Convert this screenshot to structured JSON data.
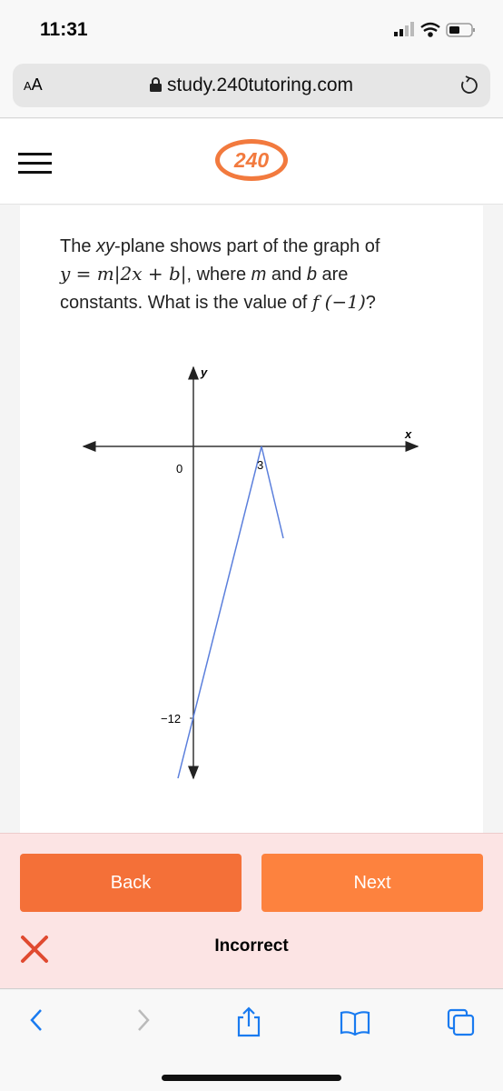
{
  "status_bar": {
    "time": "11:31",
    "icons": [
      "signal-icon",
      "wifi-icon",
      "battery-icon"
    ]
  },
  "browser": {
    "text_size_label_small": "A",
    "text_size_label_large": "A",
    "url": "study.240tutoring.com",
    "lock_icon": "lock-icon",
    "reload_icon": "reload-icon"
  },
  "header": {
    "menu_icon": "hamburger-icon",
    "logo_text": "240",
    "brand_color": "#f27a3e"
  },
  "question": {
    "line1_pre": "The ",
    "line1_em": "xy",
    "line1_post": "-plane shows part of the graph of",
    "equation": "y = m|2x + b|",
    "line2_post": ", where ",
    "m": "m",
    "and": " and ",
    "b": "b",
    "are": " are",
    "line3": "constants. What is the value of ",
    "expr": "f (−1)",
    "qmark": "?"
  },
  "graph": {
    "x_label": "x",
    "y_label": "y",
    "origin_label": "0",
    "x_tick_label": "3",
    "y_tick_label": "−12",
    "line_color": "#5b7fdc"
  },
  "feedback": {
    "back_label": "Back",
    "next_label": "Next",
    "result": "Incorrect",
    "back_color": "#f47038",
    "next_color": "#fd823e",
    "background": "#fce4e4"
  },
  "toolbar": {
    "icons": [
      "back-arrow-icon",
      "forward-arrow-icon",
      "share-icon",
      "bookmarks-icon",
      "tabs-icon"
    ]
  }
}
